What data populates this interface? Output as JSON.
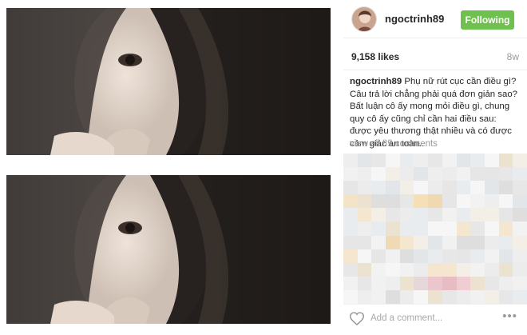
{
  "post": {
    "username": "ngoctrinh89",
    "follow_label": "Following",
    "likes": "9,158 likes",
    "time": "8w",
    "caption_user": "ngoctrinh89",
    "caption_text": " Phụ nữ rút cục cần điều gì? Câu trả lời chẳng phải quá đơn giản sao? Bất luận cô ấy mong mỏi điều gì, chung quy cô ấy cũng chỉ cần hai điều sau: được yêu thương thật nhiều và có được cảm giác an toàn..",
    "view_all_comments": "view all 89 comments",
    "comment_placeholder": "Add a comment...",
    "more_label": "•••"
  },
  "icons": {
    "heart": "heart-icon",
    "more": "more-options-icon",
    "avatar": "avatar"
  },
  "colors": {
    "follow_button": "#70c050",
    "muted_text": "#999999",
    "text": "#262626"
  }
}
